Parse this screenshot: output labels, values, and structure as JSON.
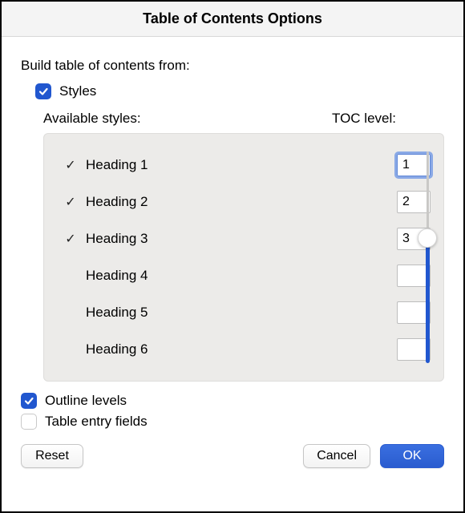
{
  "dialog": {
    "title": "Table of Contents Options",
    "build_from_label": "Build table of contents from:",
    "styles_checkbox": {
      "label": "Styles",
      "checked": true
    },
    "available_styles_label": "Available styles:",
    "toc_level_label": "TOC level:",
    "styles": [
      {
        "name": "Heading 1",
        "checked": true,
        "level": "1",
        "focused": true
      },
      {
        "name": "Heading 2",
        "checked": true,
        "level": "2",
        "focused": false
      },
      {
        "name": "Heading 3",
        "checked": true,
        "level": "3",
        "focused": false
      },
      {
        "name": "Heading 4",
        "checked": false,
        "level": "",
        "focused": false
      },
      {
        "name": "Heading 5",
        "checked": false,
        "level": "",
        "focused": false
      },
      {
        "name": "Heading 6",
        "checked": false,
        "level": "",
        "focused": false
      }
    ],
    "outline_levels_checkbox": {
      "label": "Outline levels",
      "checked": true
    },
    "table_entry_fields_checkbox": {
      "label": "Table entry fields",
      "checked": false
    },
    "buttons": {
      "reset": "Reset",
      "cancel": "Cancel",
      "ok": "OK"
    }
  },
  "glyphs": {
    "check": "✓"
  },
  "colors": {
    "accent": "#2157cf"
  }
}
